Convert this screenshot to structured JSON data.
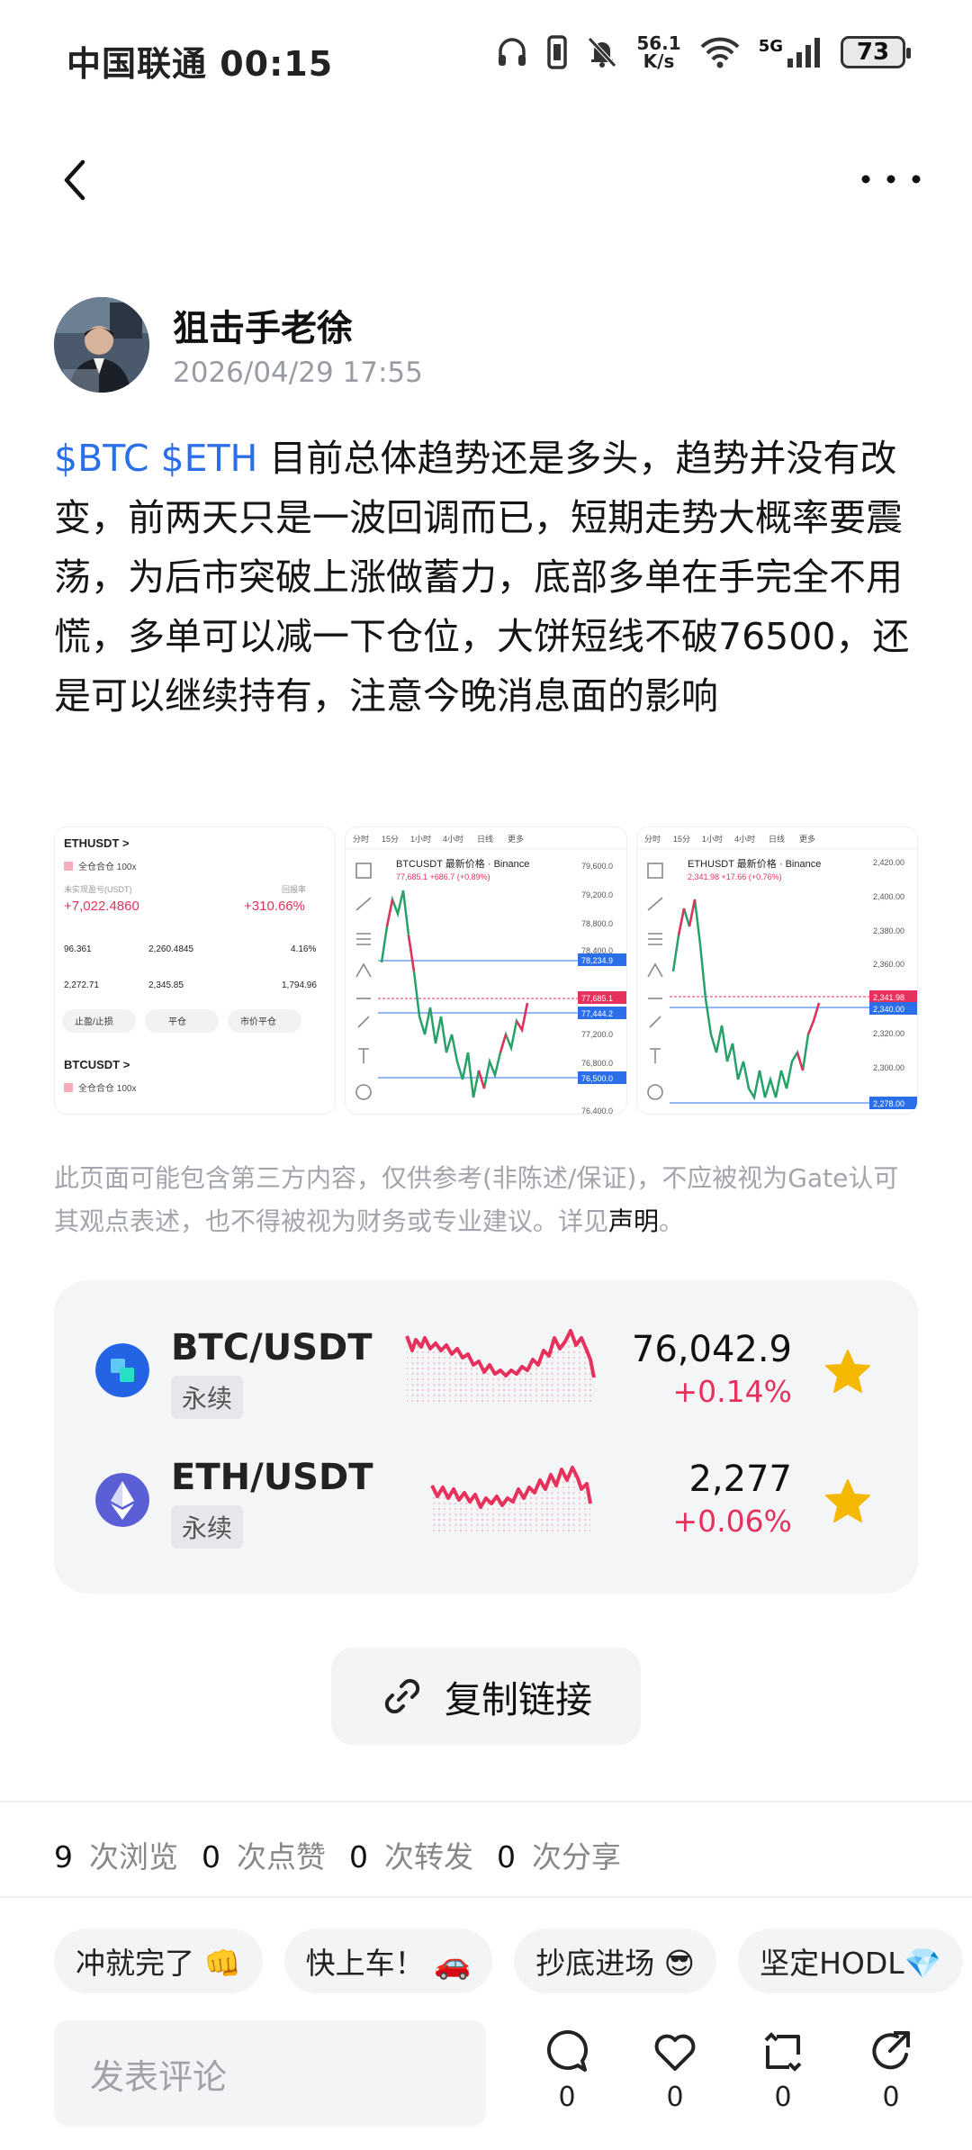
{
  "status_bar": {
    "carrier_time": "中国联通 00:15",
    "speed_value": "56.1",
    "speed_unit": "K/s",
    "network": "5G",
    "battery": "73"
  },
  "author": {
    "name": "狙击手老徐",
    "time": "2026/04/29 17:55"
  },
  "post": {
    "tags": "$BTC $ETH",
    "text": " 目前总体趋势还是多头，趋势并没有改变，前两天只是一波回调而已，短期走势大概率要震荡，为后市突破上涨做蓄力，底部多单在手完全不用慌，多单可以减一下仓位，大饼短线不破76500，还是可以继续持有，注意今晚消息面的影响"
  },
  "thumbnails": {
    "t1": {
      "pair": "ETHUSDT >",
      "mode": "全仓合仓 100x",
      "pnl_label": "未实现盈亏(USDT)",
      "pnl": "+7,022.4860",
      "roe_label": "回报率",
      "roe": "+310.66%",
      "row1": [
        "96.361",
        "2,260.4845",
        "4.16%"
      ],
      "row2": [
        "2,272.71",
        "2,345.85",
        "1,794.96"
      ],
      "buttons": [
        "止盈/止损",
        "平仓",
        "市价平仓"
      ],
      "pair2": "BTCUSDT >"
    },
    "t2": {
      "title": "BTCUSDT 最新价格 · Binance",
      "sub": "77,685.1 +686.7 (+0.89%)",
      "levels": [
        "79,600.0",
        "79,200.0",
        "78,800.0",
        "78,400.0",
        "78,234.9",
        "77,685.1",
        "77,444.2",
        "77,200.0",
        "76,800.0",
        "76,500.0",
        "76,400.0"
      ]
    },
    "t3": {
      "title": "ETHUSDT 最新价格 · Binance",
      "sub": "2,341.98 +17.66 (+0.76%)",
      "levels": [
        "2,420.00",
        "2,400.00",
        "2,380.00",
        "2,360.00",
        "2,341.98",
        "2,340.00",
        "2,320.00",
        "2,300.00",
        "2,278.00"
      ]
    },
    "timeframes": [
      "分时",
      "15分",
      "1小时",
      "4小时",
      "日线",
      "更多"
    ]
  },
  "disclaimer": {
    "text": "此页面可能包含第三方内容，仅供参考(非陈述/保证)，不应被视为Gate认可其观点表述，也不得被视为财务或专业建议。详见",
    "link": "声明",
    "end": "。"
  },
  "markets": [
    {
      "pair": "BTC/USDT",
      "type": "永续",
      "price": "76,042.9",
      "change": "+0.14%",
      "icon": "btc-coin-icon",
      "color": "#2463e4"
    },
    {
      "pair": "ETH/USDT",
      "type": "永续",
      "price": "2,277",
      "change": "+0.06%",
      "icon": "eth-coin-icon",
      "color": "#5b5fd6"
    }
  ],
  "copy_link": "复制链接",
  "stats": {
    "views": "9",
    "views_label": "次浏览",
    "likes": "0",
    "likes_label": "次点赞",
    "reposts": "0",
    "reposts_label": "次转发",
    "shares": "0",
    "shares_label": "次分享"
  },
  "chips": [
    "冲就完了 👊",
    "快上车！ 🚗",
    "抄底进场 😎",
    "坚定HODL💎"
  ],
  "comment": {
    "placeholder": "发表评论"
  },
  "actions": {
    "comment": "0",
    "like": "0",
    "repost": "0",
    "share": "0"
  },
  "colors": {
    "accent_blue": "#2b6fe8",
    "red": "#e5315c",
    "star": "#f5b800"
  }
}
